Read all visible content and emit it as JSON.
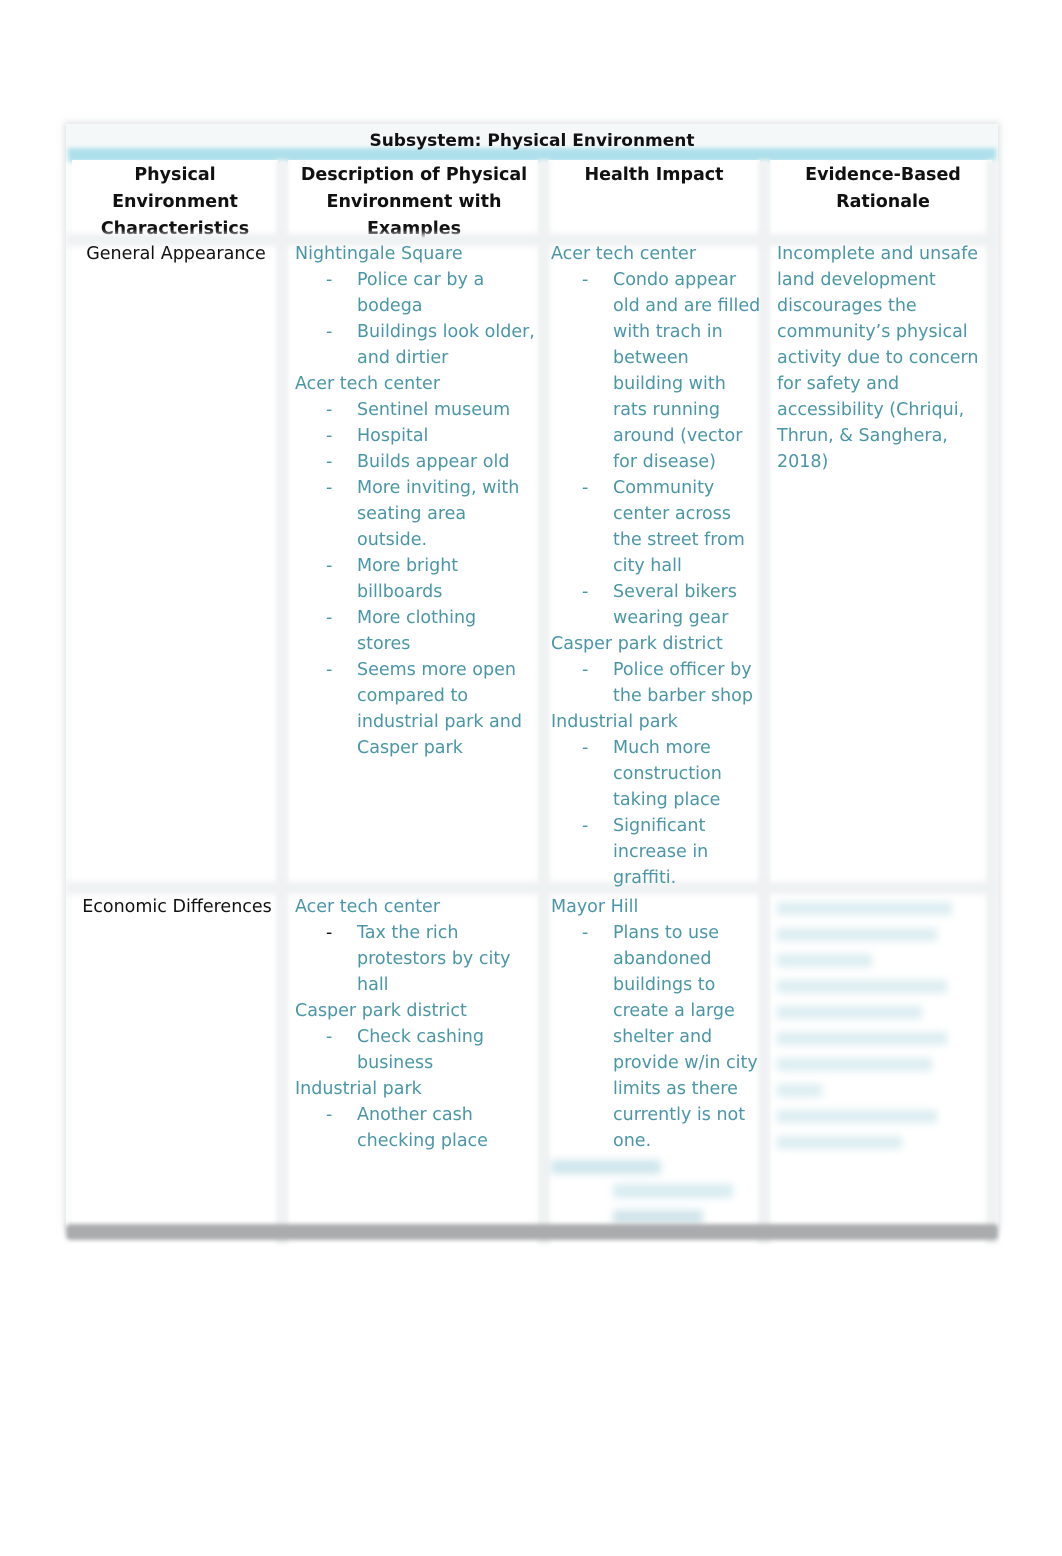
{
  "document": {
    "table_title": "Subsystem: Physical Environment",
    "columns": [
      "Physical Environment Characteristics",
      "Description of Physical Environment with Examples",
      "Health Impact",
      "Evidence-Based Rationale"
    ],
    "header_lines": {
      "col1": [
        "Physical",
        "Environment",
        "Characteristics"
      ],
      "col2": [
        "Description of Physical",
        "Environment with",
        "Examples"
      ],
      "col3": [
        "Health Impact"
      ],
      "col4": [
        "Evidence-Based",
        "Rationale"
      ]
    },
    "rows": [
      {
        "characteristic": "General Appearance",
        "description": [
          {
            "place": "Nightingale Square",
            "items": [
              "Police car by a bodega",
              "Buildings look older, and dirtier"
            ]
          },
          {
            "place": "Acer tech center",
            "items": [
              "Sentinel museum",
              "Hospital",
              "Builds appear old",
              "More inviting, with seating area outside.",
              "More bright billboards",
              "More clothing stores",
              "Seems more open compared to industrial park and Casper park"
            ]
          }
        ],
        "health_impact": [
          {
            "place": "Acer tech center",
            "items": [
              "Condo appear old and are filled with trach in between building with rats running around (vector for disease)",
              "Community center across the street from city hall",
              "Several bikers wearing gear"
            ]
          },
          {
            "place": "Casper park district",
            "items": [
              "Police officer by the barber shop"
            ]
          },
          {
            "place": "Industrial park",
            "items": [
              "Much more construction taking place",
              "Significant increase in graffiti."
            ]
          }
        ],
        "rationale": "Incomplete and unsafe land development discourages the community’s physical activity due to concern for safety and accessibility (Chriqui, Thrun, & Sanghera, 2018)"
      },
      {
        "characteristic": "Economic Differences",
        "description": [
          {
            "place": "Acer tech center",
            "items": [
              "Tax the rich protestors by city hall"
            ]
          },
          {
            "place": "Casper park district",
            "items": [
              "Check cashing business"
            ]
          },
          {
            "place": "Industrial park",
            "items": [
              "Another cash checking place"
            ]
          }
        ],
        "health_impact": [
          {
            "place": "Mayor Hill",
            "items": [
              "Plans to use abandoned buildings to create a large shelter and provide w/in city limits as there currently is not one."
            ]
          }
        ],
        "rationale": ""
      }
    ],
    "bullet_marker": "-",
    "colors": {
      "body_text": "#4a96a6",
      "header_text": "#111111",
      "title_stripe": "#aee0ec"
    }
  }
}
